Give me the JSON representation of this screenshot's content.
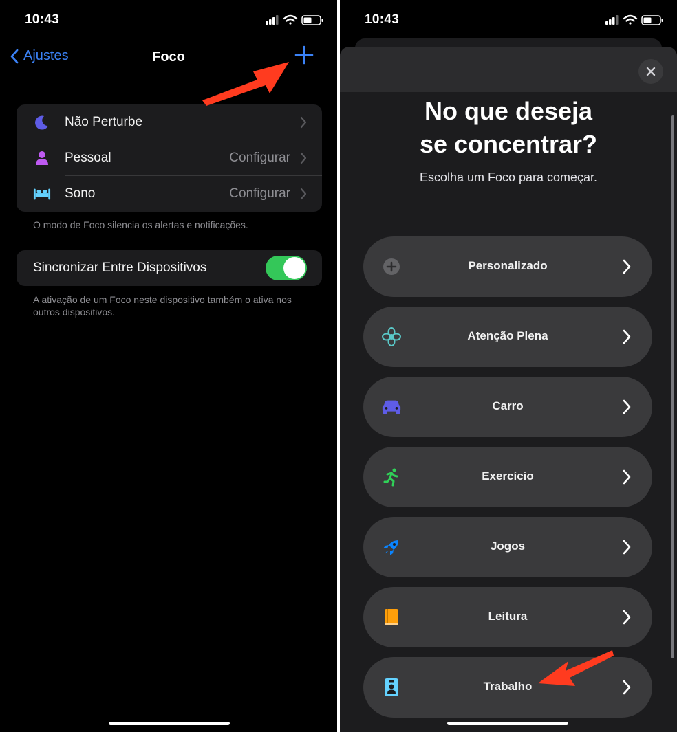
{
  "left": {
    "status": {
      "time": "10:43"
    },
    "nav": {
      "back_label": "Ajustes",
      "title": "Foco"
    },
    "focus_list": [
      {
        "label": "Não Perturbe",
        "value": "",
        "icon": "moon-icon",
        "color": "#5e5ce6"
      },
      {
        "label": "Pessoal",
        "value": "Configurar",
        "icon": "person-icon",
        "color": "#bf5af2"
      },
      {
        "label": "Sono",
        "value": "Configurar",
        "icon": "bed-icon",
        "color": "#64d2ff"
      }
    ],
    "focus_footnote": "O modo de Foco silencia os alertas e notificações.",
    "sync": {
      "label": "Sincronizar Entre Dispositivos",
      "enabled": true
    },
    "sync_footnote": "A ativação de um Foco neste dispositivo também o ativa nos outros dispositivos."
  },
  "right": {
    "status": {
      "time": "10:43"
    },
    "headline_line1": "No que deseja",
    "headline_line2": "se concentrar?",
    "subtitle": "Escolha um Foco para começar.",
    "options": [
      {
        "label": "Personalizado",
        "icon": "plus-circle-icon",
        "color": "#8e8e93"
      },
      {
        "label": "Atenção Plena",
        "icon": "flower-icon",
        "color": "#5ac8c8"
      },
      {
        "label": "Carro",
        "icon": "car-icon",
        "color": "#5e5ce6"
      },
      {
        "label": "Exercício",
        "icon": "running-icon",
        "color": "#30d158"
      },
      {
        "label": "Jogos",
        "icon": "rocket-icon",
        "color": "#0a84ff"
      },
      {
        "label": "Leitura",
        "icon": "book-icon",
        "color": "#ff9f0a"
      },
      {
        "label": "Trabalho",
        "icon": "badge-icon",
        "color": "#64d2ff"
      }
    ]
  },
  "colors": {
    "accent": "#3b82f6",
    "toggle_on": "#34c759",
    "annotation_arrow": "#ff3b1f"
  }
}
